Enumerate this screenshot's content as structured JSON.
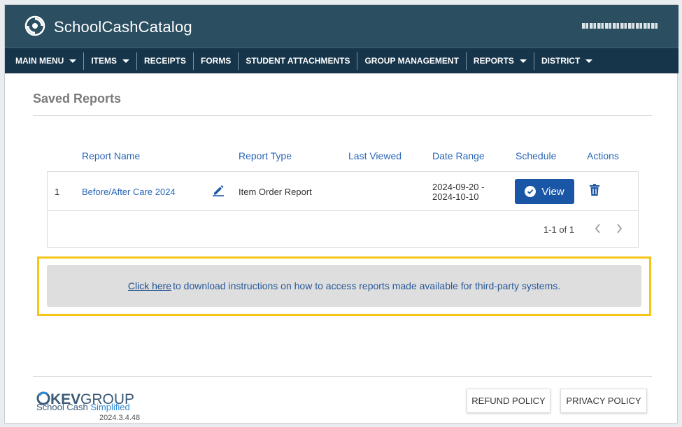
{
  "app": {
    "brand": "SchoolCashCatalog",
    "colors": {
      "header_bg": "#2b4e61",
      "nav_bg": "#16344a",
      "link": "#2a66b8",
      "primary_button": "#1a56a6",
      "highlight_border": "#f5c518"
    }
  },
  "nav": {
    "items": [
      {
        "label": "MAIN MENU",
        "dropdown": true
      },
      {
        "label": "ITEMS",
        "dropdown": true
      },
      {
        "label": "RECEIPTS",
        "dropdown": false
      },
      {
        "label": "FORMS",
        "dropdown": false
      },
      {
        "label": "STUDENT ATTACHMENTS",
        "dropdown": false
      },
      {
        "label": "GROUP MANAGEMENT",
        "dropdown": false
      },
      {
        "label": "REPORTS",
        "dropdown": true
      },
      {
        "label": "DISTRICT",
        "dropdown": true
      }
    ]
  },
  "page": {
    "title": "Saved Reports"
  },
  "table": {
    "headers": {
      "name": "Report Name",
      "type": "Report Type",
      "last_viewed": "Last Viewed",
      "date_range": "Date Range",
      "schedule": "Schedule",
      "actions": "Actions"
    },
    "rows": [
      {
        "index": "1",
        "name": "Before/After Care 2024",
        "type": "Item Order Report",
        "last_viewed": "",
        "date_from": "2024-09-20 -",
        "date_to": "2024-10-10",
        "view_label": "View",
        "edit_icon": "pencil-icon",
        "delete_icon": "trash-icon"
      }
    ],
    "pagination": {
      "label": "1-1 of 1"
    }
  },
  "notice": {
    "link_text": "Click here",
    "text": "to download instructions on how to access reports made available for third-party systems."
  },
  "footer": {
    "logo_text_a": "KEV",
    "logo_text_b": "GROUP",
    "tagline_a": "School Cash ",
    "tagline_b": "Simplified",
    "version": "2024.3.4.48",
    "refund_label": "REFUND POLICY",
    "privacy_label": "PRIVACY POLICY"
  }
}
